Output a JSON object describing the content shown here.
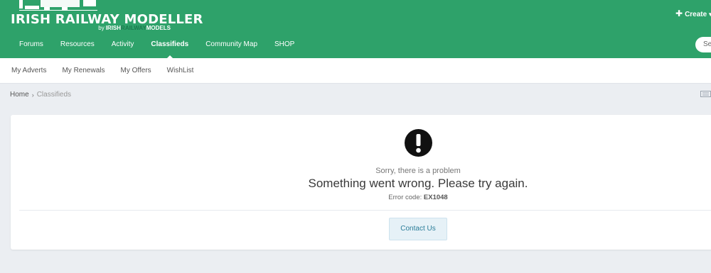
{
  "brand": {
    "title": "IRISH RAILWAY MODELLER",
    "by": "by",
    "sub1": "IRISH",
    "sub2": "RAILWAY",
    "sub3": "MODELS"
  },
  "header": {
    "create_label": "Create",
    "search_placeholder": "Se"
  },
  "nav": {
    "items": [
      {
        "label": "Forums"
      },
      {
        "label": "Resources"
      },
      {
        "label": "Activity"
      },
      {
        "label": "Classifieds"
      },
      {
        "label": "Community Map"
      },
      {
        "label": "SHOP"
      }
    ],
    "active_index": 3
  },
  "subnav": {
    "items": [
      {
        "label": "My Adverts"
      },
      {
        "label": "My Renewals"
      },
      {
        "label": "My Offers"
      },
      {
        "label": "WishList"
      }
    ]
  },
  "breadcrumb": {
    "home": "Home",
    "current": "Classifieds"
  },
  "error": {
    "sorry": "Sorry, there is a problem",
    "title": "Something went wrong. Please try again.",
    "code_label": "Error code:",
    "code": "EX1048",
    "contact_label": "Contact Us"
  },
  "colors": {
    "header_bg": "#2ea26a",
    "page_bg": "#ebeef2",
    "contact_bg": "#e6f1f7",
    "contact_text": "#2b7d99"
  },
  "icons": {
    "error": "exclamation-circle-icon",
    "create": "plus-icon",
    "caret": "caret-down-icon",
    "breadcrumb_sep": "chevron-right-icon",
    "tool": "grid-icon"
  }
}
